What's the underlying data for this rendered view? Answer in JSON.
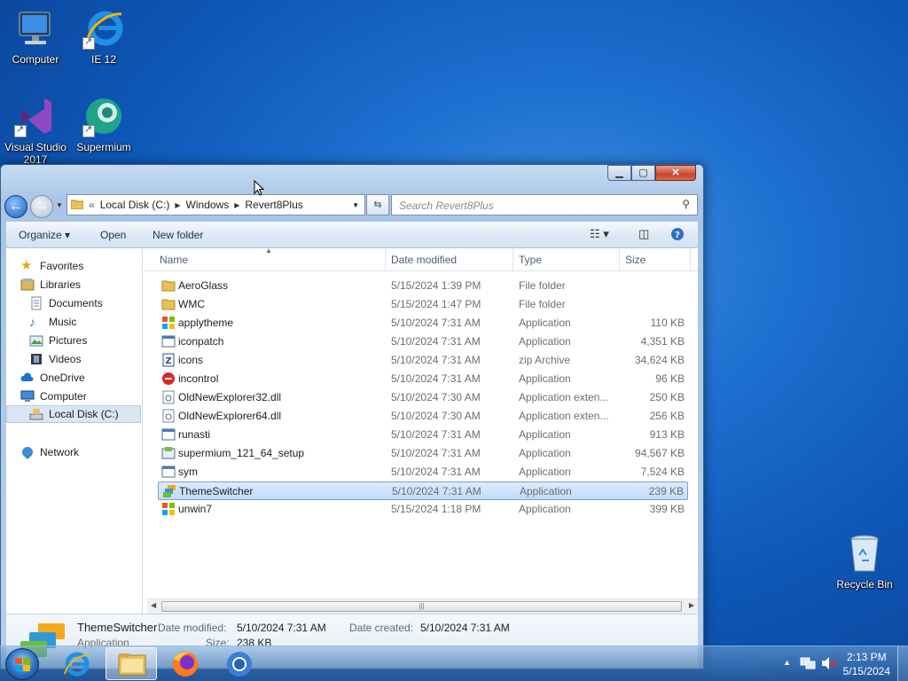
{
  "desktop": {
    "icons": [
      {
        "label": "Computer"
      },
      {
        "label": "IE 12"
      },
      {
        "label": "Visual Studio 2017"
      },
      {
        "label": "Supermium"
      },
      {
        "label": "Recycle Bin"
      }
    ]
  },
  "window": {
    "minimize": "▁",
    "maximize": "▢",
    "close": "✕",
    "address": {
      "prefix": "«",
      "crumbs": [
        "Local Disk (C:)",
        "Windows",
        "Revert8Plus"
      ]
    },
    "search_placeholder": "Search Revert8Plus",
    "toolbar": {
      "organize": "Organize ▾",
      "open": "Open",
      "new_folder": "New folder"
    },
    "nav": {
      "favorites": "Favorites",
      "libraries": "Libraries",
      "documents": "Documents",
      "music": "Music",
      "pictures": "Pictures",
      "videos": "Videos",
      "onedrive": "OneDrive",
      "computer": "Computer",
      "local_disk": "Local Disk (C:)",
      "network": "Network"
    },
    "columns": {
      "name": "Name",
      "date": "Date modified",
      "type": "Type",
      "size": "Size"
    },
    "files": [
      {
        "name": "AeroGlass",
        "date": "5/15/2024 1:39 PM",
        "type": "File folder",
        "size": "",
        "icon": "folder"
      },
      {
        "name": "WMC",
        "date": "5/15/2024 1:47 PM",
        "type": "File folder",
        "size": "",
        "icon": "folder"
      },
      {
        "name": "applytheme",
        "date": "5/10/2024 7:31 AM",
        "type": "Application",
        "size": "110 KB",
        "icon": "app-flag"
      },
      {
        "name": "iconpatch",
        "date": "5/10/2024 7:31 AM",
        "type": "Application",
        "size": "4,351 KB",
        "icon": "app-window"
      },
      {
        "name": "icons",
        "date": "5/10/2024 7:31 AM",
        "type": "zip Archive",
        "size": "34,624 KB",
        "icon": "zip"
      },
      {
        "name": "incontrol",
        "date": "5/10/2024 7:31 AM",
        "type": "Application",
        "size": "96 KB",
        "icon": "app-red"
      },
      {
        "name": "OldNewExplorer32.dll",
        "date": "5/10/2024 7:30 AM",
        "type": "Application exten...",
        "size": "250 KB",
        "icon": "dll"
      },
      {
        "name": "OldNewExplorer64.dll",
        "date": "5/10/2024 7:30 AM",
        "type": "Application exten...",
        "size": "256 KB",
        "icon": "dll"
      },
      {
        "name": "runasti",
        "date": "5/10/2024 7:31 AM",
        "type": "Application",
        "size": "913 KB",
        "icon": "app-window"
      },
      {
        "name": "supermium_121_64_setup",
        "date": "5/10/2024 7:31 AM",
        "type": "Application",
        "size": "94,567 KB",
        "icon": "setup"
      },
      {
        "name": "sym",
        "date": "5/10/2024 7:31 AM",
        "type": "Application",
        "size": "7,524 KB",
        "icon": "app-window"
      },
      {
        "name": "ThemeSwitcher",
        "date": "5/10/2024 7:31 AM",
        "type": "Application",
        "size": "239 KB",
        "icon": "theme",
        "selected": true
      },
      {
        "name": "unwin7",
        "date": "5/15/2024 1:18 PM",
        "type": "Application",
        "size": "399 KB",
        "icon": "app-flag"
      }
    ],
    "details": {
      "name": "ThemeSwitcher",
      "type": "Application",
      "date_modified_label": "Date modified:",
      "date_modified": "5/10/2024 7:31 AM",
      "date_created_label": "Date created:",
      "date_created": "5/10/2024 7:31 AM",
      "size_label": "Size:",
      "size": "238 KB"
    }
  },
  "taskbar": {
    "time": "2:13 PM",
    "date": "5/15/2024",
    "tray_arrow": "▲"
  },
  "colors": {
    "selection": "#c1dbfc",
    "desktop": "#1d6fd0"
  }
}
